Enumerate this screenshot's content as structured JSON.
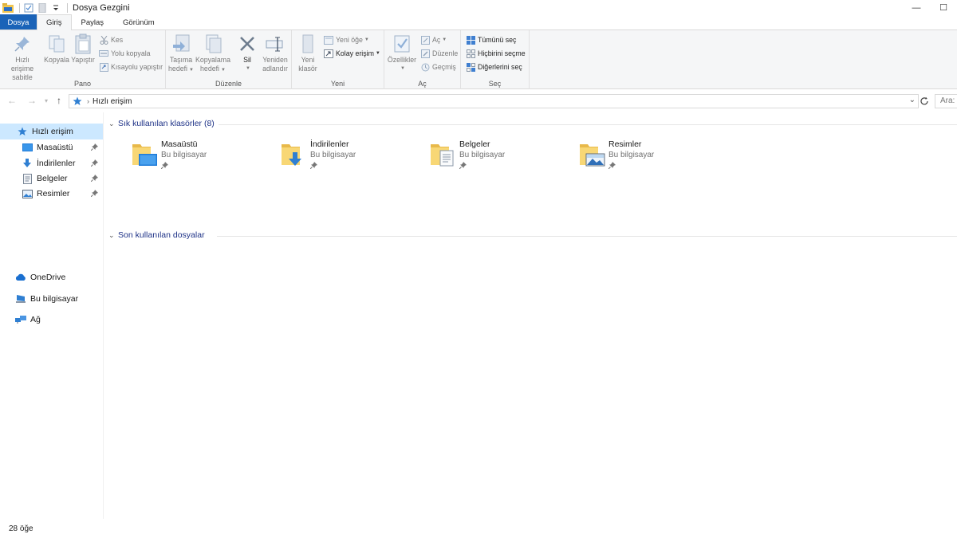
{
  "window": {
    "title": "Dosya Gezgini",
    "controls": {
      "minimize": "—",
      "maximize": "☐"
    }
  },
  "tabs": [
    {
      "label": "Dosya",
      "active": false
    },
    {
      "label": "Giriş",
      "active": true
    },
    {
      "label": "Paylaş",
      "active": false
    },
    {
      "label": "Görünüm",
      "active": false
    }
  ],
  "ribbon": {
    "pano": {
      "label": "Pano",
      "pin_line1": "Hızlı erişime",
      "pin_line2": "sabitle",
      "copy": "Kopyala",
      "paste": "Yapıştır",
      "cut": "Kes",
      "copy_path": "Yolu kopyala",
      "paste_shortcut": "Kısayolu yapıştır"
    },
    "duzenle": {
      "label": "Düzenle",
      "move_line1": "Taşıma",
      "move_line2": "hedefi",
      "copyto_line1": "Kopyalama",
      "copyto_line2": "hedefi",
      "delete": "Sil",
      "rename_line1": "Yeniden",
      "rename_line2": "adlandır"
    },
    "yeni": {
      "label": "Yeni",
      "new_folder_line1": "Yeni",
      "new_folder_line2": "klasör",
      "new_item": "Yeni öğe",
      "easy_access": "Kolay erişim"
    },
    "ac": {
      "label": "Aç",
      "properties": "Özellikler",
      "open": "Aç",
      "edit": "Düzenle",
      "history": "Geçmiş"
    },
    "sec": {
      "label": "Seç",
      "select_all": "Tümünü seç",
      "select_none": "Hiçbirini seçme",
      "invert": "Diğerlerini seç"
    }
  },
  "address": {
    "path": "Hızlı erişim",
    "search_placeholder": "Ara: H"
  },
  "sidebar": {
    "quick_access": "Hızlı erişim",
    "pinned": [
      {
        "label": "Masaüstü",
        "icon": "desktop-icon"
      },
      {
        "label": "İndirilenler",
        "icon": "download-icon"
      },
      {
        "label": "Belgeler",
        "icon": "documents-icon"
      },
      {
        "label": "Resimler",
        "icon": "pictures-icon"
      }
    ],
    "onedrive": "OneDrive",
    "this_pc": "Bu bilgisayar",
    "network": "Ağ"
  },
  "content": {
    "frequent_header": "Sık kullanılan klasörler (8)",
    "recent_header": "Son kullanılan dosyalar",
    "folders": [
      {
        "name": "Masaüstü",
        "location": "Bu bilgisayar",
        "overlay": "desktop"
      },
      {
        "name": "İndirilenler",
        "location": "Bu bilgisayar",
        "overlay": "download"
      },
      {
        "name": "Belgeler",
        "location": "Bu bilgisayar",
        "overlay": "documents"
      },
      {
        "name": "Resimler",
        "location": "Bu bilgisayar",
        "overlay": "pictures"
      }
    ]
  },
  "status": {
    "item_count": "28 öğe"
  },
  "colors": {
    "file_tab": "#1a63b8",
    "selection": "#cce8ff",
    "folder": "#f8d775",
    "accent_blue": "#1e7bd8",
    "section_header": "#1e3287"
  }
}
